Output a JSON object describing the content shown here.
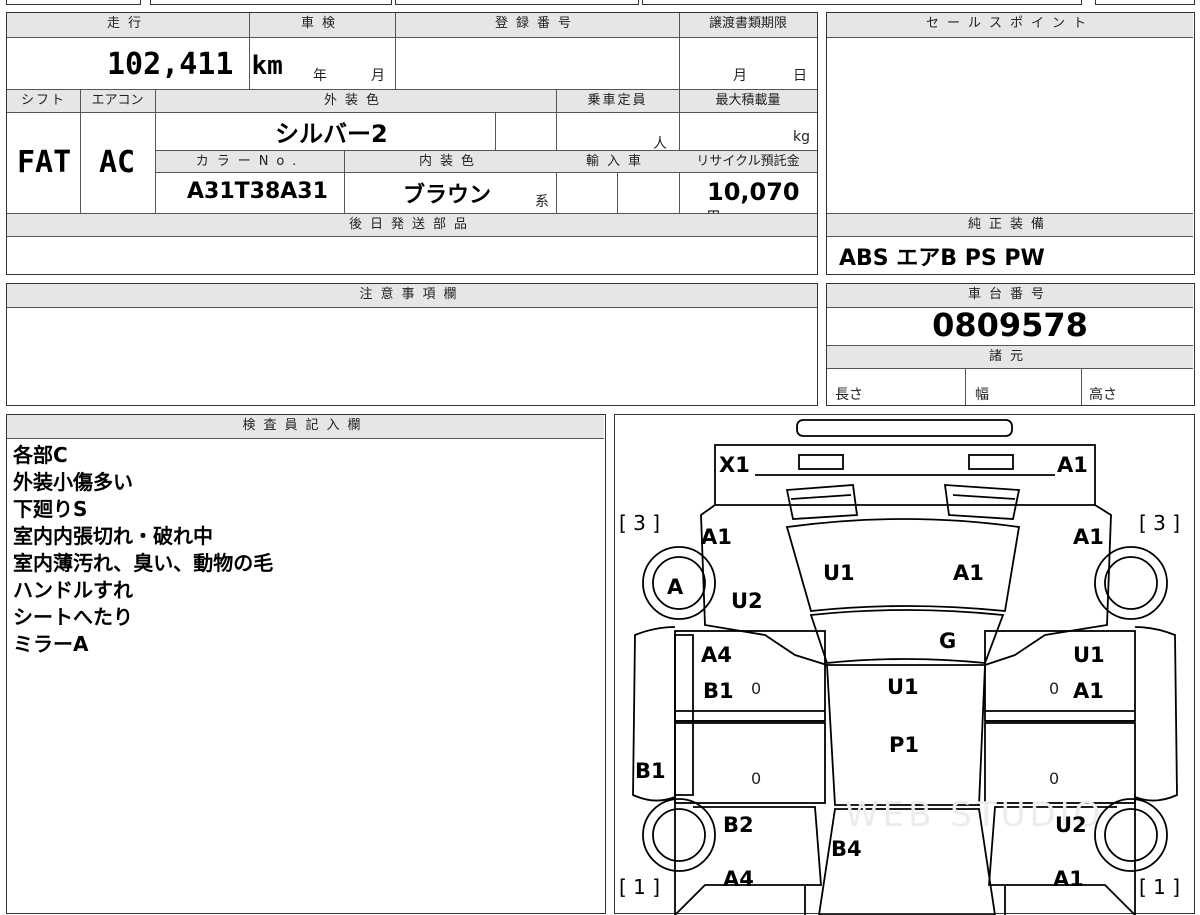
{
  "mileage": {
    "label": "走行",
    "value": "102,411",
    "unit": "km"
  },
  "inspection": {
    "label": "車検",
    "year": "年",
    "month": "月"
  },
  "registration": {
    "label": "登録番号",
    "value": ""
  },
  "transfer_deadline": {
    "label": "譲渡書類期限",
    "month": "月",
    "day": "日"
  },
  "sales_point": {
    "label": "セールスポイント",
    "value": ""
  },
  "shift": {
    "label": "シフト",
    "value": "FAT"
  },
  "aircon": {
    "label": "エアコン",
    "value": "AC"
  },
  "exterior_color": {
    "label": "外装色",
    "value": "シルバー2"
  },
  "capacity": {
    "label": "乗車定員",
    "unit": "人"
  },
  "max_load": {
    "label": "最大積載量",
    "unit": "kg"
  },
  "color_no": {
    "label": "カラーNo.",
    "value": "A31T38A31"
  },
  "interior_color": {
    "label": "内装色",
    "value": "ブラウン",
    "suffix": "系"
  },
  "import": {
    "label": "輸入車"
  },
  "recycle_fee": {
    "label": "リサイクル預託金",
    "value": "10,070",
    "unit": "円"
  },
  "later_parts": {
    "label": "後日発送部品",
    "value": ""
  },
  "equipment": {
    "label": "純正装備",
    "value": "ABS エアB PS PW"
  },
  "caution": {
    "label": "注意事項欄",
    "value": ""
  },
  "chassis_number": {
    "label": "車台番号",
    "value": "0809578"
  },
  "specs": {
    "label": "諸元",
    "length": "長さ",
    "width": "幅",
    "height": "高さ"
  },
  "inspector": {
    "label": "検査員記入欄",
    "notes": [
      "各部C",
      "外装小傷多い",
      "下廻りS",
      "室内内張切れ・破れ中",
      "室内薄汚れ、臭い、動物の毛",
      "ハンドルすれ",
      "シートへたり",
      "ミラーA"
    ]
  },
  "diagram": {
    "codes": [
      "X1",
      "A1",
      "A1",
      "A1",
      "A",
      "U2",
      "U1",
      "A1",
      "G",
      "A4",
      "B1",
      "U1",
      "U1",
      "A1",
      "P1",
      "B1",
      "B2",
      "U2",
      "B4",
      "A4",
      "A1"
    ],
    "tire_ratings": [
      "[ 3 ]",
      "[ 3 ]",
      "[ 1 ]",
      "[ 1 ]"
    ],
    "zeros": [
      "0",
      "0",
      "0",
      "0"
    ],
    "watermark": "WEB STUDIO"
  }
}
